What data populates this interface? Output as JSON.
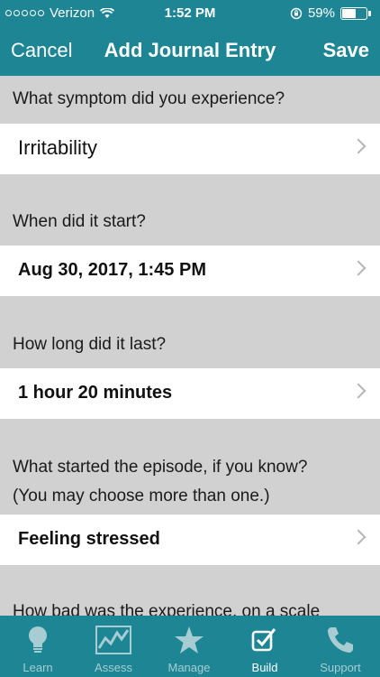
{
  "status_bar": {
    "carrier": "Verizon",
    "time": "1:52 PM",
    "battery": "59%",
    "battery_level": 0.59
  },
  "navbar": {
    "cancel_label": "Cancel",
    "title": "Add Journal Entry",
    "save_label": "Save"
  },
  "form": {
    "symptom_question": "What symptom did you experience?",
    "symptom_value": "Irritability",
    "start_question": "When did it start?",
    "start_value": "Aug 30, 2017, 1:45 PM",
    "duration_question": "How long did it last?",
    "duration_value": "1 hour 20 minutes",
    "trigger_question_line1": "What started the episode, if you know?",
    "trigger_question_line2": "(You may choose more than one.)",
    "trigger_value": "Feeling stressed",
    "severity_question_partial": "How bad was the experience, on a scale"
  },
  "tabbar": {
    "tabs": [
      {
        "label": "Learn",
        "icon": "lightbulb-icon"
      },
      {
        "label": "Assess",
        "icon": "chart-icon"
      },
      {
        "label": "Manage",
        "icon": "star-icon"
      },
      {
        "label": "Build",
        "icon": "checkbox-icon"
      },
      {
        "label": "Support",
        "icon": "phone-icon"
      }
    ],
    "active": "Build"
  },
  "colors": {
    "brand": "#1d8594",
    "section_bg": "#d1d1d1",
    "inactive_tab": "#a7cdd3"
  }
}
